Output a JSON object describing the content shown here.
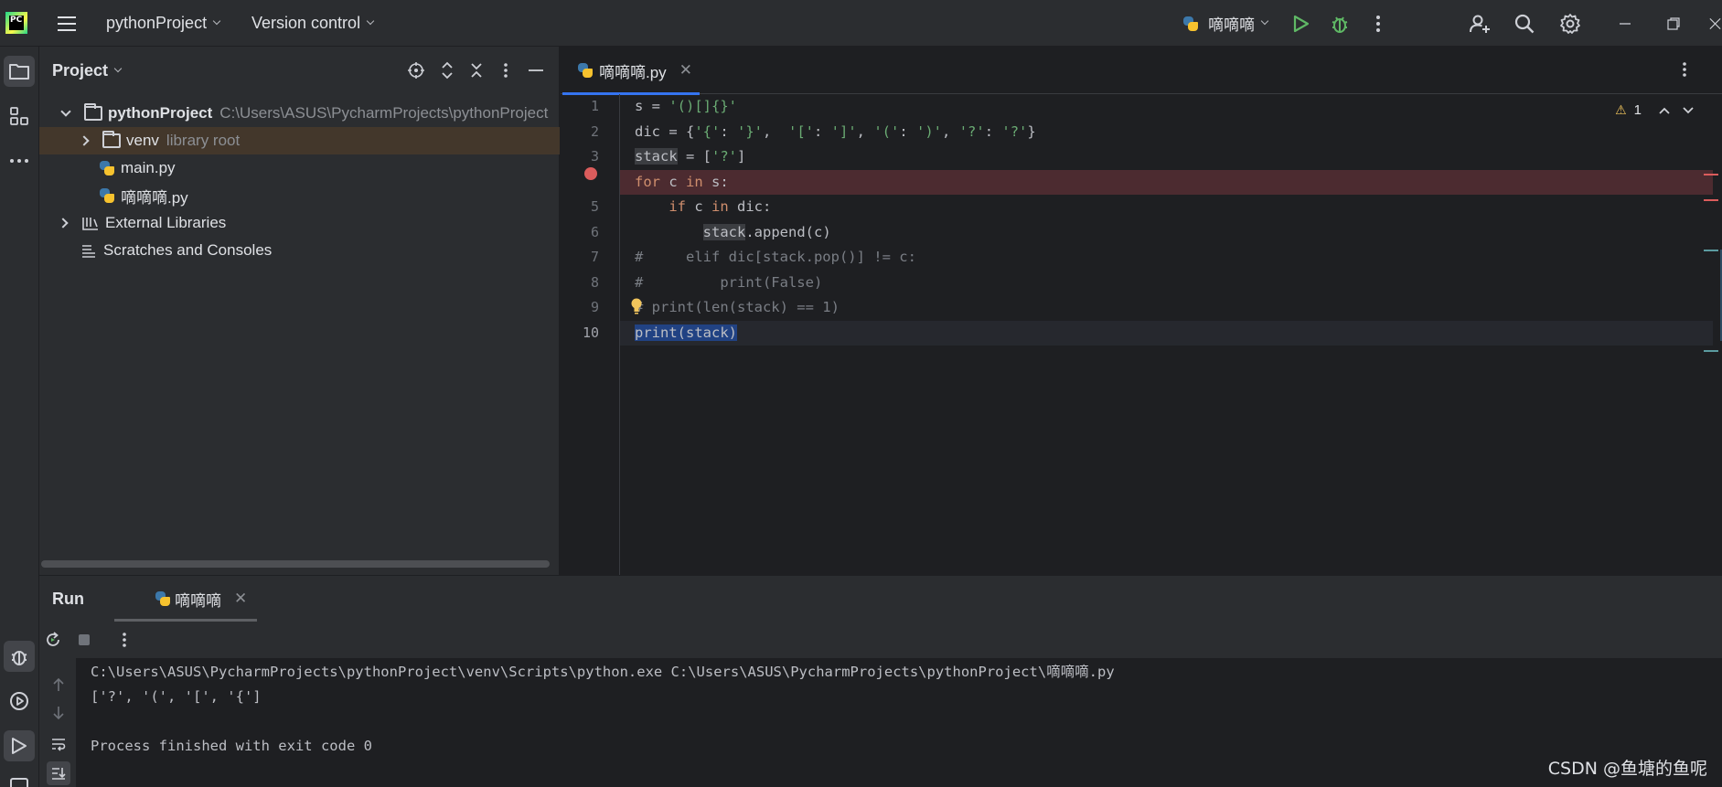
{
  "titlebar": {
    "logo_text": "PC",
    "project_name": "pythonProject",
    "version_control": "Version control",
    "run_config": "嘀嘀嘀"
  },
  "project_panel": {
    "title": "Project",
    "tree": [
      {
        "label": "pythonProject",
        "hint": "C:\\Users\\ASUS\\PycharmProjects\\pythonProject"
      },
      {
        "label": "venv",
        "hint": "library root"
      },
      {
        "label": "main.py",
        "hint": ""
      },
      {
        "label": "嘀嘀嘀.py",
        "hint": ""
      },
      {
        "label": "External Libraries",
        "hint": ""
      },
      {
        "label": "Scratches and Consoles",
        "hint": ""
      }
    ]
  },
  "editor": {
    "tab_label": "嘀嘀嘀.py",
    "warning_count": "1",
    "line_numbers": [
      "1",
      "2",
      "3",
      "4",
      "5",
      "6",
      "7",
      "8",
      "9",
      "10"
    ],
    "code": {
      "l1_a": "s = ",
      "l1_b": "'()[]{}'",
      "l2_a": "dic = {",
      "l2_b": "'{'",
      "l2_c": ": ",
      "l2_d": "'}'",
      "l2_e": ",  ",
      "l2_f": "'['",
      "l2_g": ": ",
      "l2_h": "']'",
      "l2_i": ", ",
      "l2_j": "'('",
      "l2_k": ": ",
      "l2_l": "')'",
      "l2_m": ", ",
      "l2_n": "'?'",
      "l2_o": ": ",
      "l2_p": "'?'",
      "l2_q": "}",
      "l3_a": "stack",
      "l3_b": " = [",
      "l3_c": "'?'",
      "l3_d": "]",
      "l4_a": "for",
      "l4_b": " c ",
      "l4_c": "in",
      "l4_d": " s:",
      "l5_a": "    ",
      "l5_b": "if",
      "l5_c": " c ",
      "l5_d": "in",
      "l5_e": " dic:",
      "l6_a": "        ",
      "l6_b": "stack",
      "l6_c": ".append(c)",
      "l7": "#     elif dic[stack.pop()] != c:",
      "l8": "#         print(False)",
      "l9": "# print(len(stack) == 1)",
      "l10": "print(stack)"
    }
  },
  "run_panel": {
    "title": "Run",
    "tab_label": "嘀嘀嘀",
    "output": [
      "C:\\Users\\ASUS\\PycharmProjects\\pythonProject\\venv\\Scripts\\python.exe C:\\Users\\ASUS\\PycharmProjects\\pythonProject\\嘀嘀嘀.py",
      "['?', '(', '[', '{']",
      "",
      "Process finished with exit code 0"
    ]
  },
  "watermark": "CSDN @鱼塘的鱼呢",
  "colors": {
    "accent": "#3574f0",
    "breakpoint": "#db5c5c",
    "run_green": "#5fb865",
    "keyword": "#cf8e6d",
    "string": "#6aab73"
  }
}
